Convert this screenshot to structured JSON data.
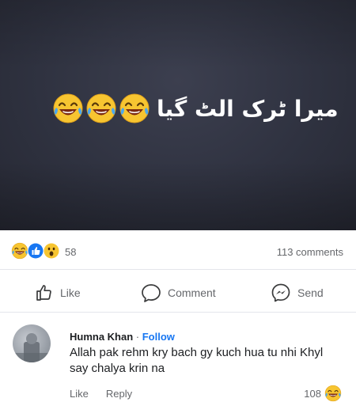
{
  "post": {
    "caption": "میرا ٹرک الٹ گیا",
    "caption_emoji": "laughing-crying-emoji",
    "caption_emoji_count": 3
  },
  "stats": {
    "reaction_icons": [
      "haha-icon",
      "like-icon",
      "wow-icon"
    ],
    "reaction_count": "58",
    "comments_label": "113 comments"
  },
  "actions": {
    "like": "Like",
    "comment": "Comment",
    "send": "Send"
  },
  "comment": {
    "author": "Humna Khan",
    "separator": " · ",
    "follow": "Follow",
    "text": "Allah pak rehm kry bach gy kuch hua tu nhi Khyl say chalya krin na",
    "like": "Like",
    "reply": "Reply",
    "reaction_count": "108"
  },
  "colors": {
    "brand_blue": "#1877f2",
    "muted_text": "#65676b",
    "image_bg": "#2f3240"
  }
}
